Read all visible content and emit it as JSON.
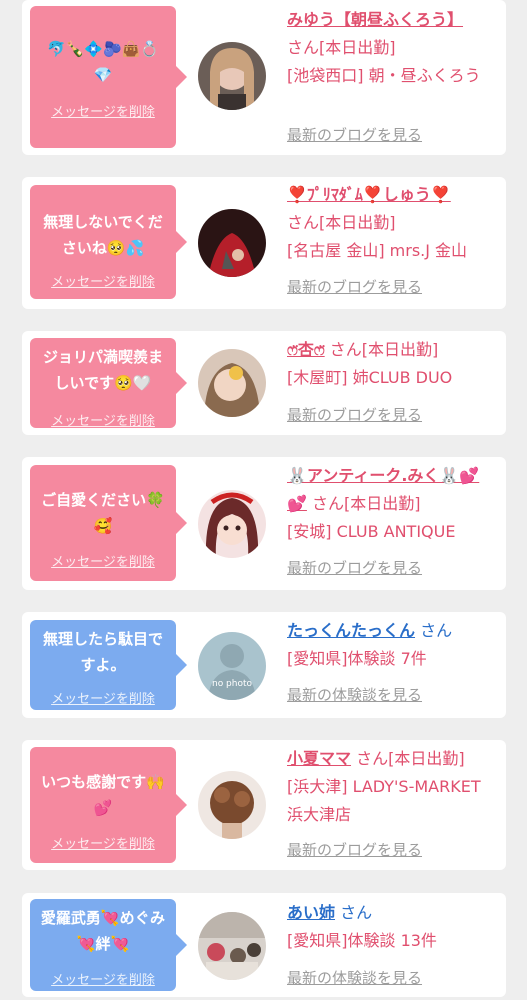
{
  "colors": {
    "page_bg": "#eeeeee",
    "card_bg": "#ffffff",
    "bubble_pink": "#f5899f",
    "bubble_blue": "#7cabef",
    "name_pink": "#e04f6e",
    "name_blue": "#2a6ec9",
    "link_gray": "#9c9c9c"
  },
  "delete_label": "メッセージを削除",
  "items": [
    {
      "message": "🐬🍾💠🫐👜💍\n💎",
      "avatar": "girl-with-bangs-avatar",
      "name": "みゆう【朝昼ふくろう】",
      "suffix": "さん[本日出勤]",
      "detail": "[池袋西口] 朝・昼ふくろう",
      "link": "最新のブログを見る"
    },
    {
      "message": "無理しないでくださいね🥺💦",
      "avatar": "red-dress-avatar",
      "name": "❣️ﾌﾟﾘﾏﾀﾞﾑ❣️しゅう❣️",
      "suffix": "さん[本日出勤]",
      "detail": "[名古屋 金山] mrs.J 金山",
      "link": "最新のブログを見る"
    },
    {
      "message": "ジョリパ満喫羨ましいです🥺🤍",
      "avatar": "peace-sign-avatar",
      "name": "ෆ̈杏ෆ̈",
      "suffix": "さん[本日出勤]",
      "detail": "[木屋町] 姉CLUB DUO",
      "link": "最新のブログを見る"
    },
    {
      "message": "ご自愛ください🍀\n🥰",
      "avatar": "anime-girl-avatar",
      "name": "🐰アンティーク.みく🐰💕💕",
      "suffix": "さん[本日出勤]",
      "detail": "[安城] CLUB ANTIQUE",
      "link": "最新のブログを見る"
    },
    {
      "message": "無理したら駄目ですよ。",
      "avatar": "no-photo-avatar",
      "avatar_text": "no photo",
      "name": "たっくんたっくん",
      "suffix": "さん",
      "detail": "[愛知県]体験談 7件",
      "link": "最新の体験談を見る"
    },
    {
      "message": "いつも感謝です🙌\n💕",
      "avatar": "hairstyle-avatar",
      "name": "小夏ママ",
      "suffix": "さん[本日出勤]",
      "detail": "[浜大津] LADY'S-MARKET 浜大津店",
      "link": "最新のブログを見る"
    },
    {
      "message": "愛羅武勇💘めぐみ💘絆💘",
      "avatar": "crowd-photo-avatar",
      "name": "あい姉",
      "suffix": "さん",
      "detail": "[愛知県]体験談 13件",
      "link": "最新の体験談を見る"
    }
  ]
}
